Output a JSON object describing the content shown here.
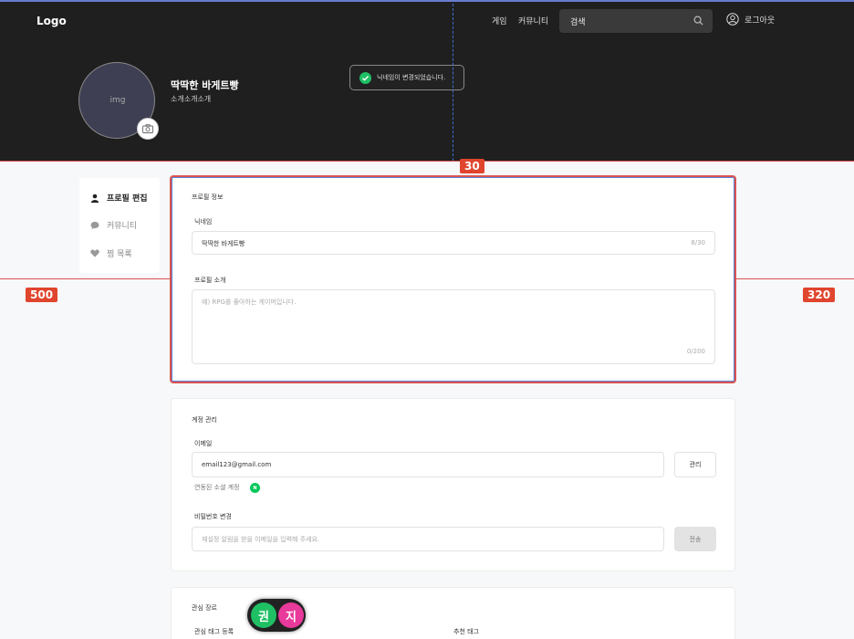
{
  "header": {
    "logo": "Logo",
    "nav": [
      "게임",
      "커뮤니티"
    ],
    "search_placeholder": "검색",
    "logout_label": "로그아웃"
  },
  "profile": {
    "avatar_text": "img",
    "name": "딱딱한 바게트빵",
    "intro": "소개소개소개"
  },
  "toast": {
    "message": "닉네임이 변경되었습니다."
  },
  "annotations": {
    "top_gap": "30",
    "left_gap": "500",
    "right_gap": "320"
  },
  "sidebar": {
    "items": [
      {
        "label": "프로필 편집",
        "icon": "user-icon",
        "active": true
      },
      {
        "label": "커뮤니티",
        "icon": "chat-bubble-icon",
        "active": false
      },
      {
        "label": "찜 목록",
        "icon": "heart-icon",
        "active": false
      }
    ]
  },
  "profile_info": {
    "title": "프로필 정보",
    "nickname_label": "닉네임",
    "nickname_value": "딱딱한 바게트빵",
    "nickname_counter": "8/30",
    "intro_label": "프로필 소개",
    "intro_placeholder": "예) RPG를 좋아하는 게이머입니다.",
    "intro_counter": "0/200"
  },
  "account": {
    "title": "계정 관리",
    "email_label": "이메일",
    "email_value": "email123@gmail.com",
    "manage_button": "관리",
    "social_label": "연동된 소셜 계정",
    "social_badge": "N",
    "password_label": "비밀번호 변경",
    "password_placeholder": "재설정 알림을 받을 이메일을 입력해 주세요.",
    "send_button": "전송"
  },
  "interests": {
    "title": "관심 장르",
    "tag_register_label": "관심 태그 등록",
    "recommended_label": "추천 태그"
  },
  "user_chips": [
    "권",
    "지"
  ],
  "colors": {
    "header_bg": "#1f1f1f",
    "accent_red": "#e0452d",
    "naver_green": "#03c75a",
    "chip_green": "#1fbf64",
    "chip_pink": "#e83a9b"
  }
}
